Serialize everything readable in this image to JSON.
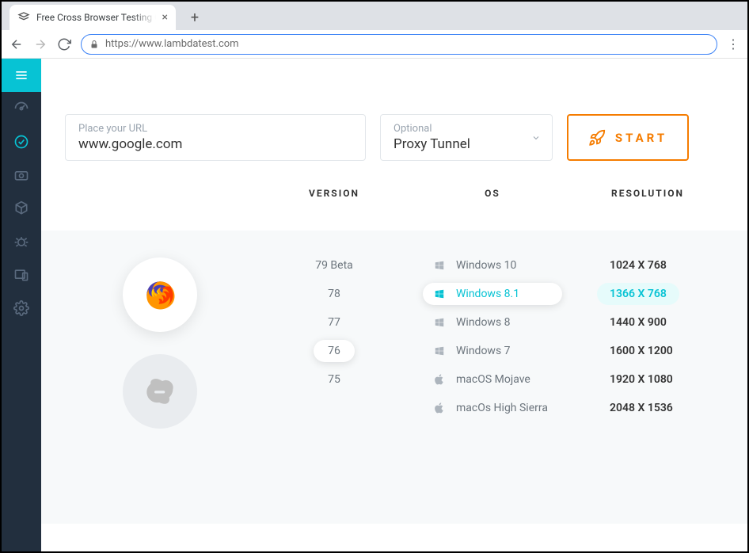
{
  "browser_chrome": {
    "tab_title": "Free Cross Browser Testing Cloud",
    "url": "https://www.lambdatest.com"
  },
  "controls": {
    "url_label": "Place your URL",
    "url_value": "www.google.com",
    "proxy_label": "Optional",
    "proxy_value": "Proxy Tunnel",
    "start_label": "START"
  },
  "headers": {
    "version": "VERSION",
    "os": "OS",
    "resolution": "RESOLUTION"
  },
  "versions": [
    "79 Beta",
    "78",
    "77",
    "76",
    "75"
  ],
  "version_selected_index": 3,
  "oses": [
    {
      "label": "Windows 10",
      "icon": "windows"
    },
    {
      "label": "Windows 8.1",
      "icon": "windows"
    },
    {
      "label": "Windows 8",
      "icon": "windows"
    },
    {
      "label": "Windows 7",
      "icon": "windows"
    },
    {
      "label": "macOS Mojave",
      "icon": "apple"
    },
    {
      "label": "macOs High Sierra",
      "icon": "apple"
    }
  ],
  "os_selected_index": 1,
  "resolutions": [
    "1024 X 768",
    "1366 X 768",
    "1440 X 900",
    "1600 X 1200",
    "1920 X 1080",
    "2048 X 1536"
  ],
  "resolution_selected_index": 1
}
